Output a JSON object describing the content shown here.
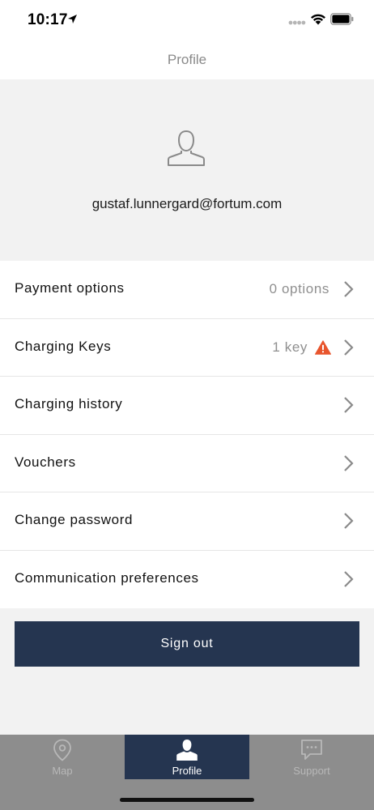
{
  "status_bar": {
    "time": "10:17"
  },
  "nav": {
    "title": "Profile"
  },
  "profile": {
    "email": "gustaf.lunnergard@fortum.com"
  },
  "menu": {
    "items": [
      {
        "label": "Payment options",
        "value": "0 options"
      },
      {
        "label": "Charging Keys",
        "value": "1 key",
        "warning": true
      },
      {
        "label": "Charging history",
        "value": ""
      },
      {
        "label": "Vouchers",
        "value": ""
      },
      {
        "label": "Change password",
        "value": ""
      },
      {
        "label": "Communication preferences",
        "value": ""
      }
    ]
  },
  "actions": {
    "sign_out_label": "Sign out"
  },
  "tab_bar": {
    "tabs": [
      {
        "label": "Map",
        "icon": "map-pin-icon",
        "active": false
      },
      {
        "label": "Profile",
        "icon": "person-icon",
        "active": true
      },
      {
        "label": "Support",
        "icon": "chat-icon",
        "active": false
      }
    ]
  },
  "colors": {
    "brand_navy": "#253550",
    "warning": "#e8552d",
    "background": "#f2f2f2"
  }
}
